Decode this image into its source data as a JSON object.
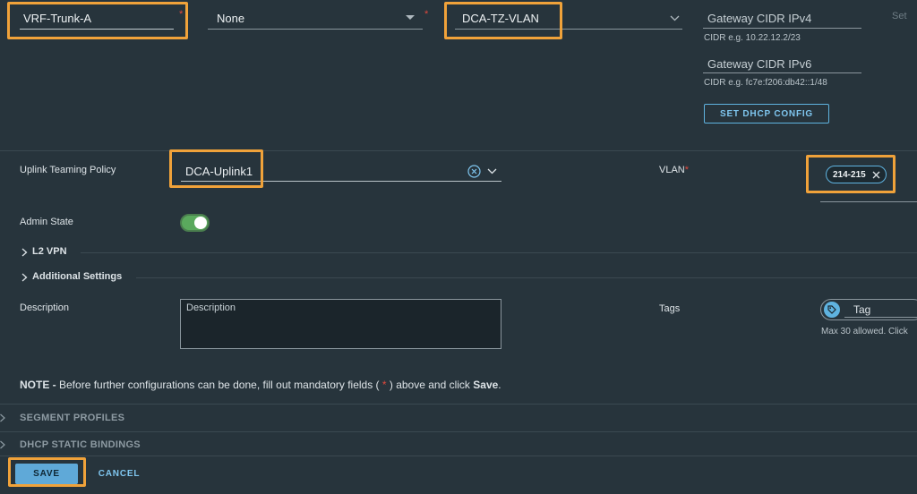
{
  "segment": {
    "name_value": "VRF-Trunk-A",
    "connectivity_value": "None",
    "transport_zone_value": "DCA-TZ-VLAN",
    "set_label": "Set",
    "gateway_ipv4_placeholder": "Gateway CIDR IPv4",
    "gateway_ipv4_hint": "CIDR e.g. 10.22.12.2/23",
    "gateway_ipv6_placeholder": "Gateway CIDR IPv6",
    "gateway_ipv6_hint": "CIDR e.g. fc7e:f206:db42::1/48",
    "set_dhcp_config_label": "SET DHCP CONFIG",
    "required_marker": "*"
  },
  "uplink": {
    "label": "Uplink Teaming Policy",
    "value": "DCA-Uplink1"
  },
  "vlan": {
    "label": "VLAN",
    "chip_value": "214-215"
  },
  "admin_state": {
    "label": "Admin State",
    "enabled": true
  },
  "sections": {
    "l2vpn_label": "L2 VPN",
    "additional_settings_label": "Additional Settings"
  },
  "description": {
    "label": "Description",
    "placeholder": "Description"
  },
  "tags": {
    "label": "Tags",
    "tag_placeholder": "Tag",
    "hint": "Max 30 allowed. Click"
  },
  "note": {
    "prefix": "NOTE -",
    "text_before": " Before further configurations can be done, fill out mandatory fields ( ",
    "star": "*",
    "text_after": " ) above and click ",
    "save_word": "Save",
    "period": "."
  },
  "collapsibles": {
    "segment_profiles": "SEGMENT PROFILES",
    "dhcp_static_bindings": "DHCP STATIC BINDINGS"
  },
  "actions": {
    "save_label": "SAVE",
    "cancel_label": "CANCEL"
  },
  "colors": {
    "background": "#27343c",
    "highlight": "#f0a23a",
    "accent": "#5fb3e0",
    "toggle_on": "#5aa95d",
    "required": "#e0483c"
  }
}
